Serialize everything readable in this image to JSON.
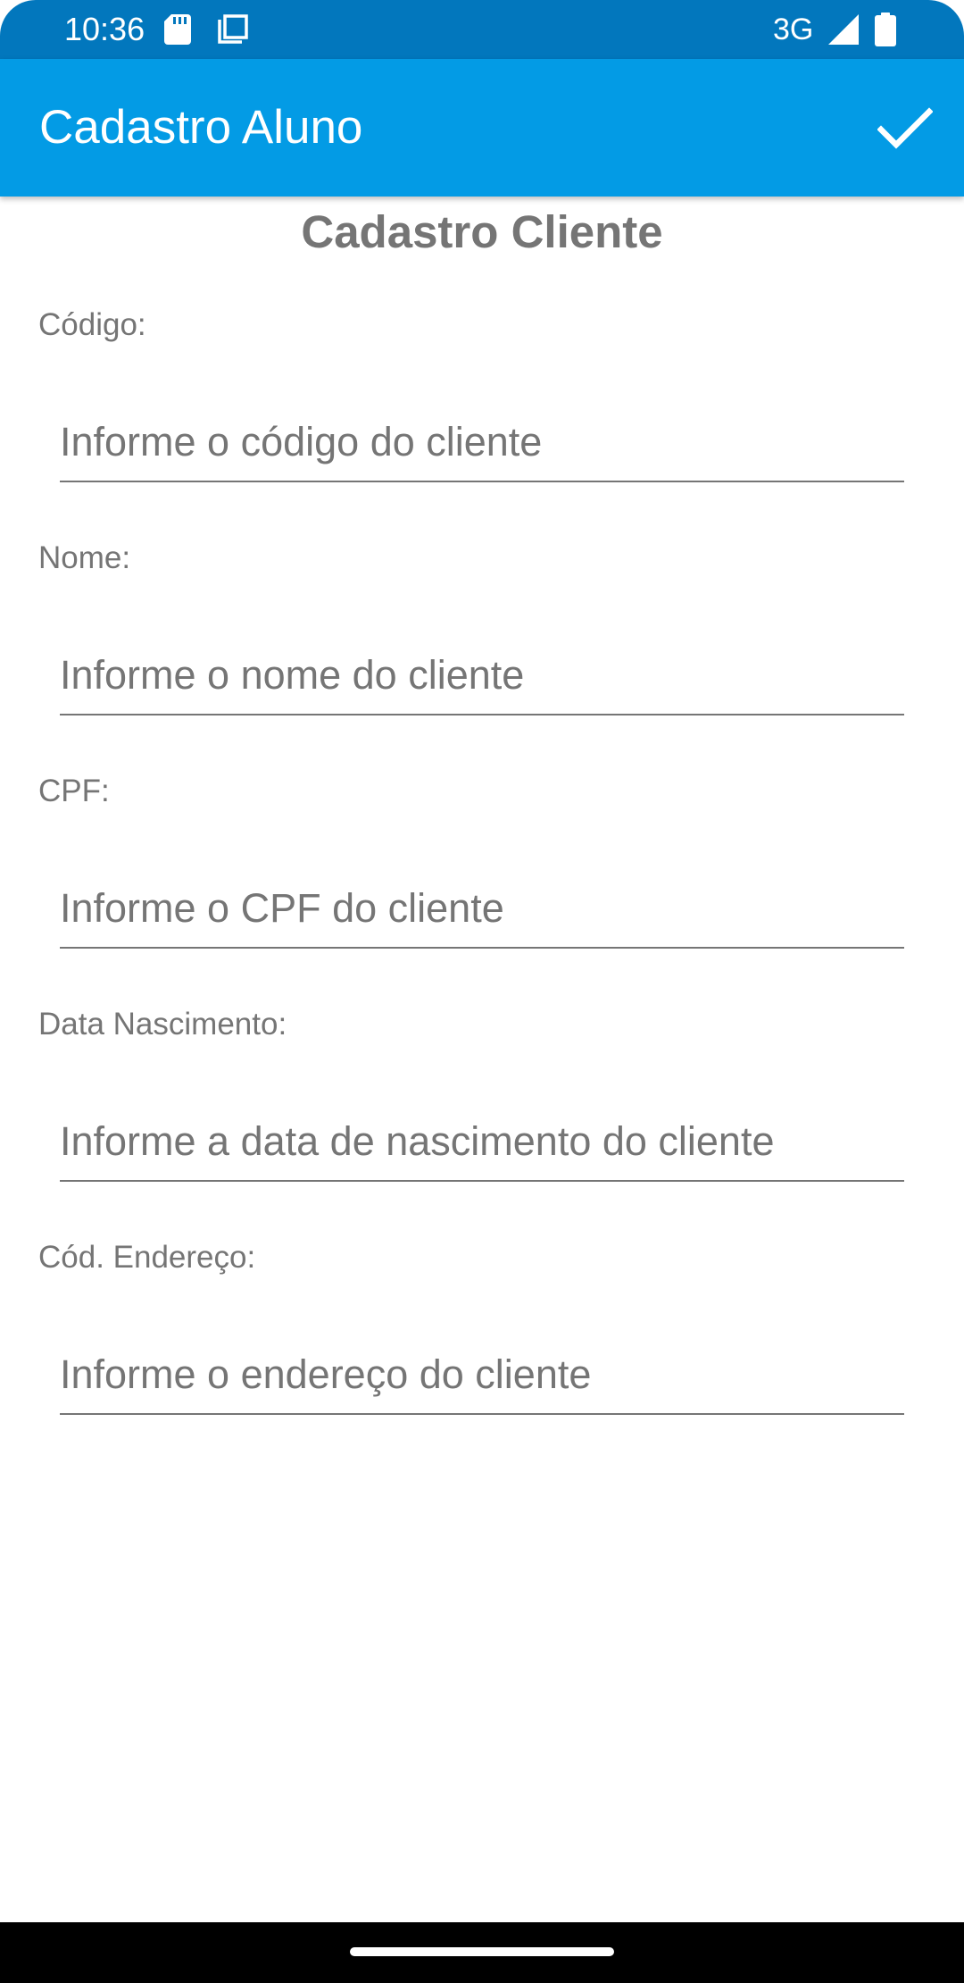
{
  "status_bar": {
    "time": "10:36",
    "network": "3G",
    "icons": [
      "sd-card-icon",
      "copy-icon",
      "signal-icon",
      "battery-icon"
    ],
    "background": "#0277bd"
  },
  "app_bar": {
    "title": "Cadastro Aluno",
    "action_icon": "check-icon",
    "background": "#039be5"
  },
  "form": {
    "heading": "Cadastro Cliente",
    "fields": [
      {
        "label": "Código:",
        "placeholder": "Informe o código do cliente",
        "value": ""
      },
      {
        "label": "Nome:",
        "placeholder": "Informe o nome do cliente",
        "value": ""
      },
      {
        "label": "CPF:",
        "placeholder": "Informe o CPF do cliente",
        "value": ""
      },
      {
        "label": "Data Nascimento:",
        "placeholder": "Informe a data de nascimento do cliente",
        "value": ""
      },
      {
        "label": "Cód. Endereço:",
        "placeholder": "Informe o endereço do cliente",
        "value": ""
      }
    ]
  },
  "colors": {
    "label_text": "#757575",
    "underline": "#757575",
    "nav_bar": "#000000"
  }
}
